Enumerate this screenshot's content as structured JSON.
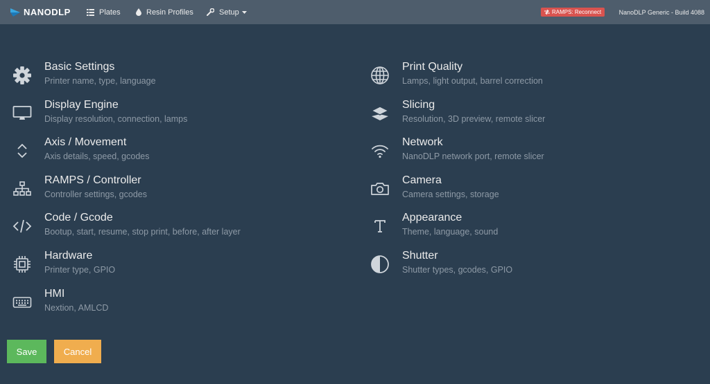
{
  "navbar": {
    "brand": "NANODLP",
    "links": [
      {
        "label": "Plates",
        "icon": "list-icon"
      },
      {
        "label": "Resin Profiles",
        "icon": "drop-icon"
      },
      {
        "label": "Setup",
        "icon": "wrench-icon"
      }
    ],
    "badge": "RAMPS: Reconnect",
    "build": "NanoDLP Generic - Build 4088"
  },
  "left_items": [
    {
      "title": "Basic Settings",
      "desc": "Printer name, type, language",
      "icon": "gear-icon"
    },
    {
      "title": "Display Engine",
      "desc": "Display resolution, connection, lamps",
      "icon": "monitor-icon"
    },
    {
      "title": "Axis / Movement",
      "desc": "Axis details, speed, gcodes",
      "icon": "chevron-up-down-icon"
    },
    {
      "title": "RAMPS / Controller",
      "desc": "Controller settings, gcodes",
      "icon": "sitemap-icon"
    },
    {
      "title": "Code / Gcode",
      "desc": "Bootup, start, resume, stop print, before, after layer",
      "icon": "code-icon"
    },
    {
      "title": "Hardware",
      "desc": "Printer type, GPIO",
      "icon": "chip-icon"
    },
    {
      "title": "HMI",
      "desc": "Nextion, AMLCD",
      "icon": "keyboard-icon"
    }
  ],
  "right_items": [
    {
      "title": "Print Quality",
      "desc": "Lamps, light output, barrel correction",
      "icon": "globe-icon"
    },
    {
      "title": "Slicing",
      "desc": "Resolution, 3D preview, remote slicer",
      "icon": "layers-icon"
    },
    {
      "title": "Network",
      "desc": "NanoDLP network port, remote slicer",
      "icon": "wifi-icon"
    },
    {
      "title": "Camera",
      "desc": "Camera settings, storage",
      "icon": "camera-icon"
    },
    {
      "title": "Appearance",
      "desc": "Theme, language, sound",
      "icon": "text-t-icon"
    },
    {
      "title": "Shutter",
      "desc": "Shutter types, gcodes, GPIO",
      "icon": "half-circle-icon"
    }
  ],
  "buttons": {
    "save": "Save",
    "cancel": "Cancel"
  },
  "colors": {
    "background": "#2b3e50",
    "navbar": "#4e5d6c",
    "save": "#5cb85c",
    "cancel": "#f0ad4e",
    "badge": "#d9534f"
  }
}
